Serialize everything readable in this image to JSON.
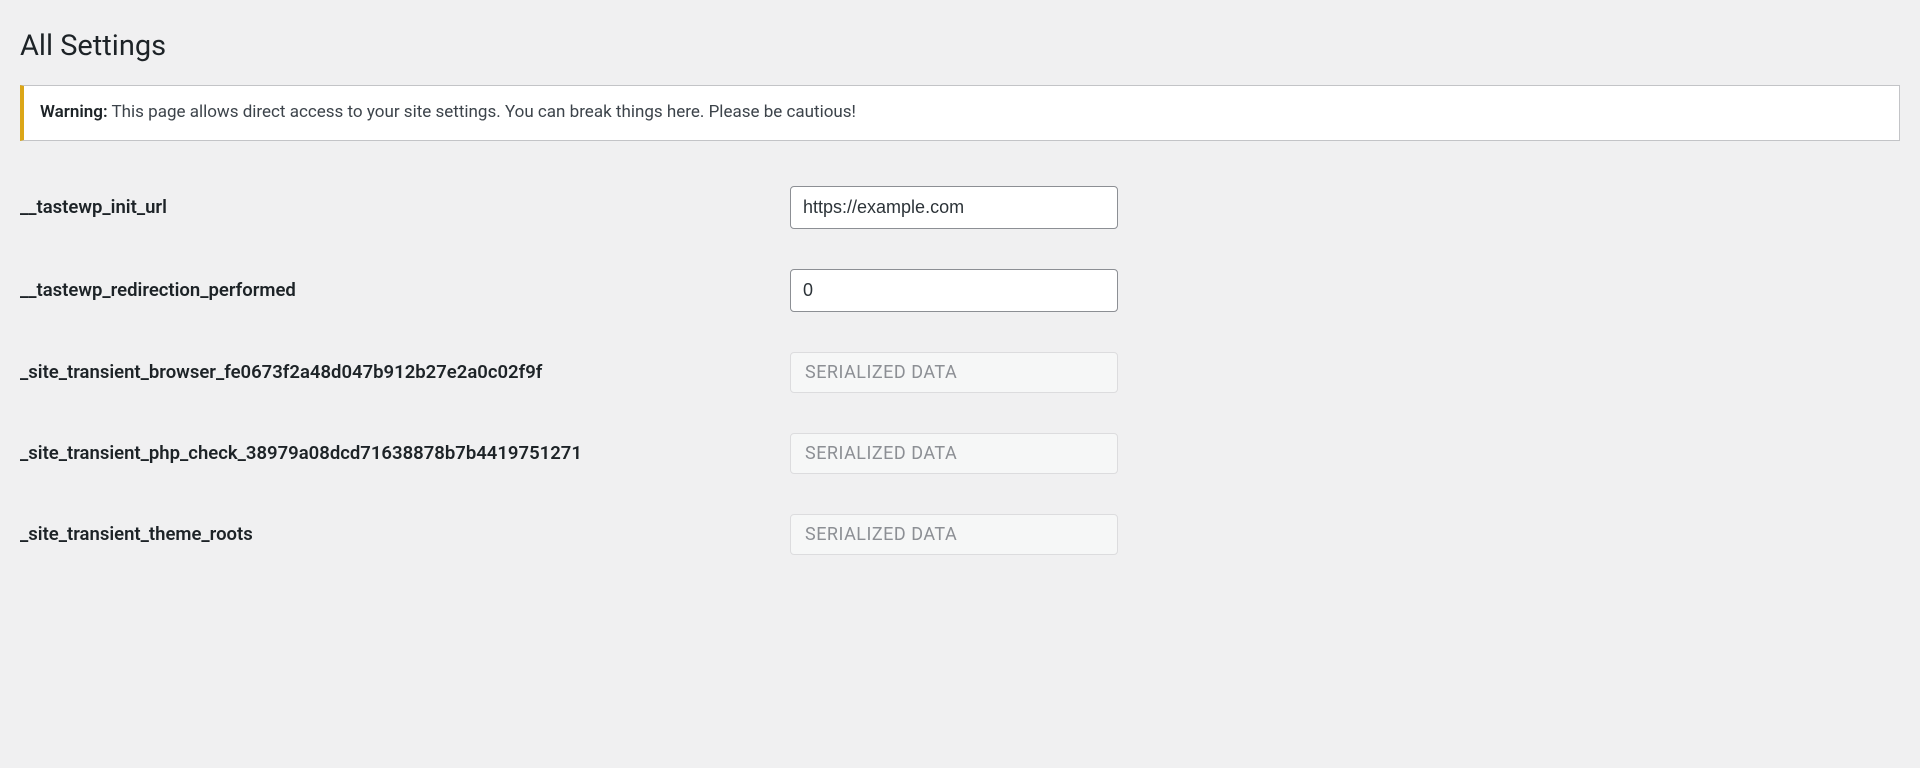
{
  "page_title": "All Settings",
  "warning": {
    "label": "Warning:",
    "text": "This page allows direct access to your site settings. You can break things here. Please be cautious!"
  },
  "rows": [
    {
      "label": "__tastewp_init_url",
      "type": "text",
      "value": "https://example.com"
    },
    {
      "label": "__tastewp_redirection_performed",
      "type": "text",
      "value": "0"
    },
    {
      "label": "_site_transient_browser_fe0673f2a48d047b912b27e2a0c02f9f",
      "type": "serialized",
      "value": "SERIALIZED DATA"
    },
    {
      "label": "_site_transient_php_check_38979a08dcd71638878b7b4419751271",
      "type": "serialized",
      "value": "SERIALIZED DATA"
    },
    {
      "label": "_site_transient_theme_roots",
      "type": "serialized",
      "value": "SERIALIZED DATA"
    }
  ]
}
